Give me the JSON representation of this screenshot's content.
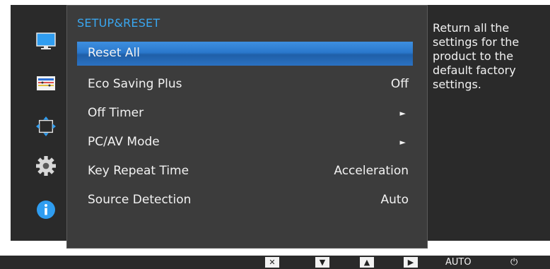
{
  "panel": {
    "title": "SETUP&RESET",
    "items": [
      {
        "label": "Reset All",
        "value": "",
        "arrow": ""
      },
      {
        "label": "Eco Saving Plus",
        "value": "Off",
        "arrow": ""
      },
      {
        "label": "Off Timer",
        "value": "",
        "arrow": "►"
      },
      {
        "label": "PC/AV Mode",
        "value": "",
        "arrow": "►"
      },
      {
        "label": "Key Repeat Time",
        "value": "Acceleration",
        "arrow": ""
      },
      {
        "label": "Source Detection",
        "value": "Auto",
        "arrow": ""
      }
    ],
    "selected_index": 0
  },
  "help": {
    "text": "Return all the settings for the product to the default factory settings."
  },
  "rail": {
    "icons": [
      "monitor-icon",
      "color-bars-icon",
      "screen-size-icon",
      "gear-icon",
      "info-icon"
    ]
  },
  "bottom_bar": {
    "close_glyph": "✕",
    "down_glyph": "▼",
    "up_glyph": "▲",
    "enter_glyph": "▶",
    "auto_label": "AUTO",
    "power_glyph": "⏻"
  },
  "colors": {
    "accent": "#3aa7f0",
    "selection": "#2a78cc",
    "background": "#2a2a2a",
    "panel": "#3c3c3c"
  }
}
